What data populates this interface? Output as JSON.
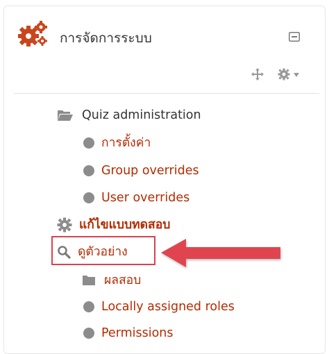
{
  "block": {
    "title": "การจัดการระบบ",
    "icons": {
      "header": "gears-icon",
      "collapse": "collapse-icon",
      "move": "move-icon",
      "actions": "cog-icon",
      "actions_caret": "chevron-down-icon"
    }
  },
  "tree": {
    "quiz_admin": "Quiz administration",
    "settings": "การตั้งค่า",
    "group_overrides": "Group overrides",
    "user_overrides": "User overrides",
    "edit_quiz": "แก้ไขแบบทดสอบ",
    "preview": "ดูตัวอย่าง",
    "results": "ผลสอบ",
    "locally_assigned_roles": "Locally assigned roles",
    "permissions": "Permissions"
  },
  "colors": {
    "link": "#b52b00",
    "text": "#333333",
    "icon_gray": "#8c8c8c",
    "brand_gear": "#c9461d",
    "annotation": "#d9414d"
  }
}
